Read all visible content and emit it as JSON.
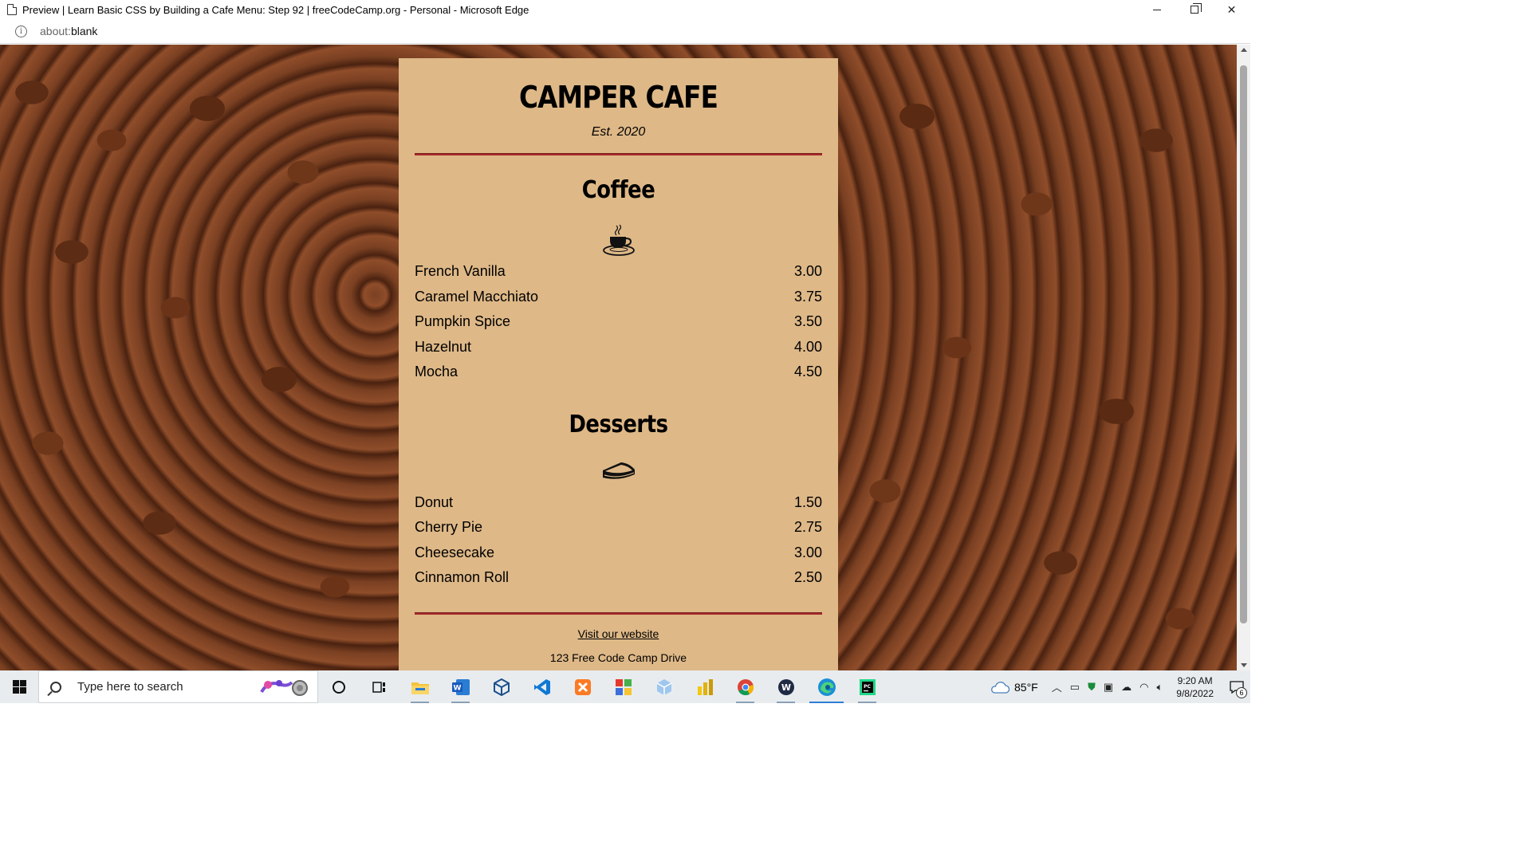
{
  "window": {
    "title": "Preview | Learn Basic CSS by Building a Cafe Menu: Step 92 | freeCodeCamp.org - Personal - Microsoft Edge"
  },
  "address_bar": {
    "scheme": "about:",
    "rest": "blank"
  },
  "menu": {
    "title": "CAMPER CAFE",
    "established": "Est. 2020",
    "sections": [
      {
        "title": "Coffee",
        "icon": "coffee-cup-icon",
        "items": [
          {
            "name": "French Vanilla",
            "price": "3.00"
          },
          {
            "name": "Caramel Macchiato",
            "price": "3.75"
          },
          {
            "name": "Pumpkin Spice",
            "price": "3.50"
          },
          {
            "name": "Hazelnut",
            "price": "4.00"
          },
          {
            "name": "Mocha",
            "price": "4.50"
          }
        ]
      },
      {
        "title": "Desserts",
        "icon": "pie-slice-icon",
        "items": [
          {
            "name": "Donut",
            "price": "1.50"
          },
          {
            "name": "Cherry Pie",
            "price": "2.75"
          },
          {
            "name": "Cheesecake",
            "price": "3.00"
          },
          {
            "name": "Cinnamon Roll",
            "price": "2.50"
          }
        ]
      }
    ],
    "footer": {
      "link_text": "Visit our website",
      "address": "123 Free Code Camp Drive"
    },
    "colors": {
      "card": "#deb887",
      "divider": "#a52a2a"
    }
  },
  "taskbar": {
    "search_placeholder": "Type here to search",
    "weather": "85°F",
    "time": "9:20 AM",
    "date": "9/8/2022",
    "notification_count": "6",
    "pinned_icons": [
      "cortana-icon",
      "task-view-icon",
      "file-explorer-icon",
      "word-icon",
      "virtualbox-icon",
      "vscode-icon",
      "xampp-icon",
      "app-grid-icon",
      "package-icon",
      "power-bi-icon",
      "chrome-icon",
      "wordpad-icon",
      "edge-icon",
      "pycharm-icon"
    ]
  }
}
